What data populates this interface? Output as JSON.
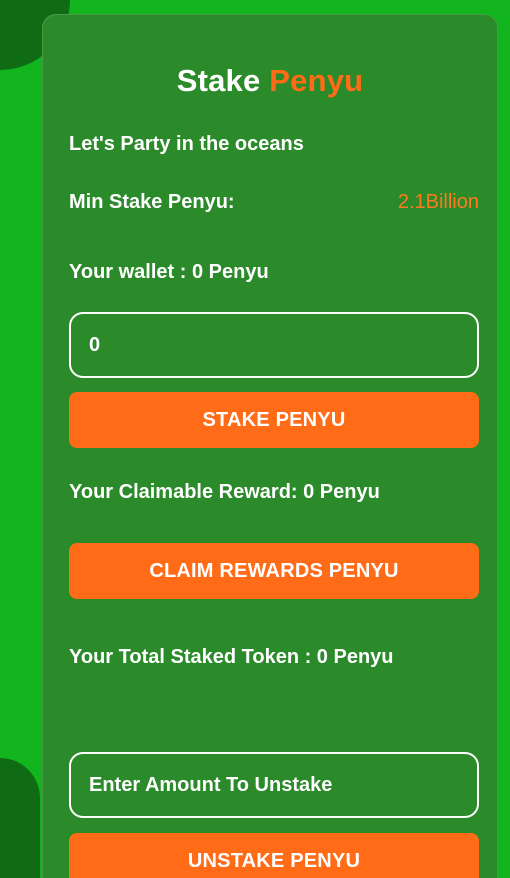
{
  "card": {
    "title_main": "Stake",
    "title_accent": "Penyu",
    "tagline": "Let's Party in the oceans",
    "min_stake_label": "Min Stake Penyu:",
    "min_stake_value": "2.1Billion",
    "wallet": "Your wallet : 0 Penyu",
    "stake_input_value": "0",
    "stake_button": "STAKE PENYU",
    "claimable_reward": "Your Claimable Reward: 0 Penyu",
    "claim_button": "CLAIM REWARDS PENYU",
    "total_staked": "Your Total Staked Token : 0 Penyu",
    "unstake_placeholder": "Enter Amount To Unstake",
    "unstake_button": "UNSTAKE PENYU"
  },
  "colors": {
    "card_bg": "#2b8a2a",
    "accent": "#ff6b17",
    "border_green": "#12b51e",
    "text": "#ffffff"
  }
}
